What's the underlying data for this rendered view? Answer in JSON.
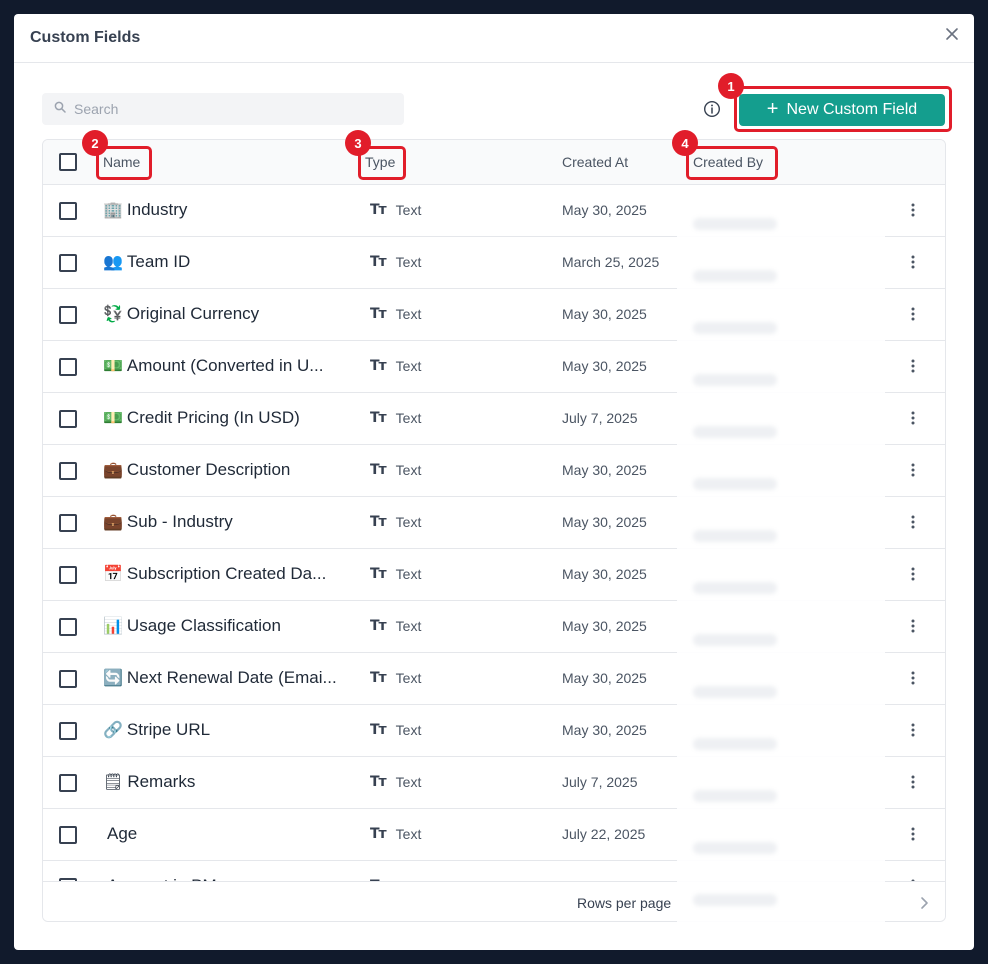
{
  "modal": {
    "title": "Custom Fields"
  },
  "toolbar": {
    "search_placeholder": "Search",
    "new_button_label": "New Custom Field"
  },
  "annotations": [
    "1",
    "2",
    "3",
    "4"
  ],
  "table": {
    "headers": {
      "name": "Name",
      "type": "Type",
      "created_at": "Created At",
      "created_by": "Created By"
    },
    "rows": [
      {
        "emoji": "🏢",
        "name": "Industry",
        "type": "Text",
        "created_at": "May 30, 2025"
      },
      {
        "emoji": "👥",
        "name": "Team ID",
        "type": "Text",
        "created_at": "March 25, 2025"
      },
      {
        "emoji": "💱",
        "name": "Original Currency",
        "type": "Text",
        "created_at": "May 30, 2025"
      },
      {
        "emoji": "💵",
        "name": "Amount (Converted in U...",
        "type": "Text",
        "created_at": "May 30, 2025"
      },
      {
        "emoji": "💵",
        "name": "Credit Pricing (In USD)",
        "type": "Text",
        "created_at": "July 7, 2025"
      },
      {
        "emoji": "💼",
        "name": "Customer Description",
        "type": "Text",
        "created_at": "May 30, 2025"
      },
      {
        "emoji": "💼",
        "name": "Sub - Industry",
        "type": "Text",
        "created_at": "May 30, 2025"
      },
      {
        "emoji": "📅",
        "name": "Subscription Created Da...",
        "type": "Text",
        "created_at": "May 30, 2025"
      },
      {
        "emoji": "📊",
        "name": "Usage Classification",
        "type": "Text",
        "created_at": "May 30, 2025"
      },
      {
        "emoji": "🔄",
        "name": "Next Renewal Date (Emai...",
        "type": "Text",
        "created_at": "May 30, 2025"
      },
      {
        "emoji": "🔗",
        "name": "Stripe URL",
        "type": "Text",
        "created_at": "May 30, 2025"
      },
      {
        "emoji": "🗒",
        "name": "Remarks",
        "type": "Text",
        "created_at": "July 7, 2025"
      },
      {
        "emoji": "",
        "name": "Age",
        "type": "Text",
        "created_at": "July 22, 2025"
      },
      {
        "emoji": "",
        "name": "Account in PM",
        "type": "Text",
        "created_at": ""
      }
    ]
  },
  "footer": {
    "rows_per_page_label": "Rows per page"
  },
  "colors": {
    "accent": "#149e8e",
    "highlight": "#e11d2a",
    "backdrop": "#111a2c"
  }
}
